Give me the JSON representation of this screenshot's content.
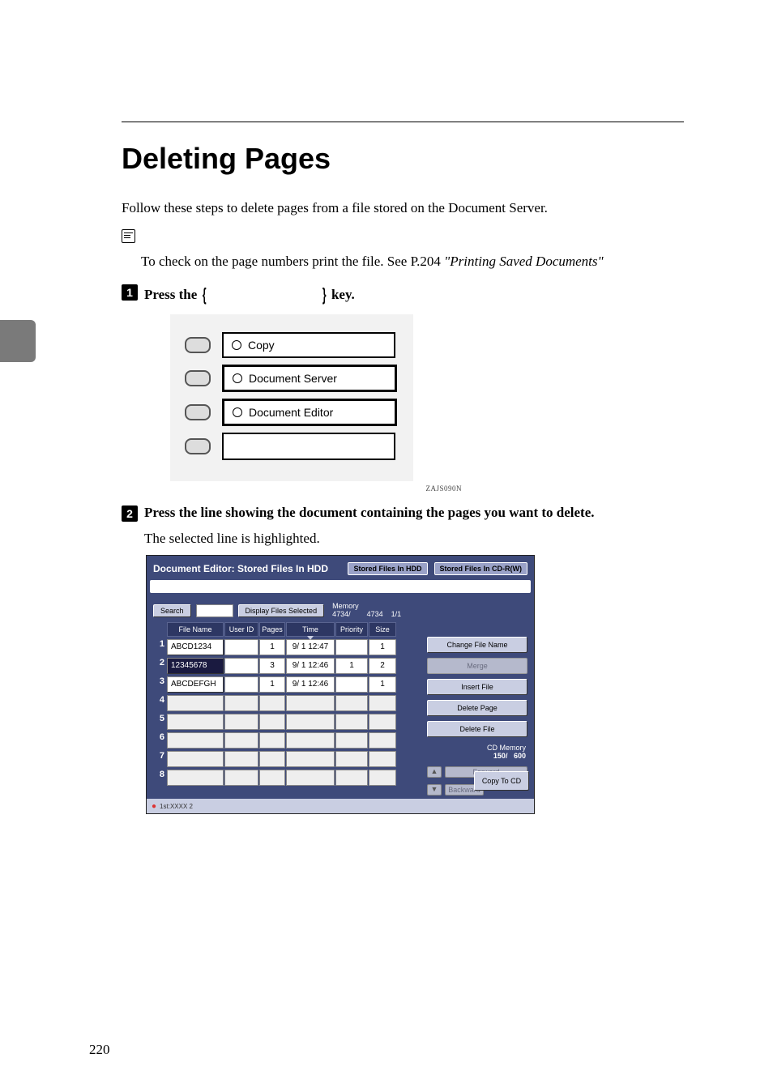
{
  "title": "Deleting Pages",
  "intro": "Follow these steps to delete pages from a file stored on the Document Server.",
  "note": {
    "prefix": "To check on the page numbers print the file. See ",
    "refpage": "P.204 ",
    "reftitle": "\"Printing Saved Documents\""
  },
  "steps": {
    "s1_a": "Press the ",
    "s1_key": "Document Editor",
    "s1_b": " key.",
    "s2": "Press the line showing the document containing the pages you want to delete.",
    "s2_body": "The selected line is highlighted."
  },
  "mode_panel": {
    "items": [
      "Copy",
      "Document Server",
      "Document Editor"
    ],
    "code": "ZAJS090N"
  },
  "screen": {
    "title": "Document Editor: Stored Files In HDD",
    "tabs": {
      "hdd": "Stored Files In HDD",
      "cd": "Stored Files In CD-R(W)"
    },
    "toolbar": {
      "search": "Search",
      "display": "Display Files Selected",
      "memory_label": "Memory",
      "memory_cur": "4734",
      "memory_tot": "4734",
      "page_cur": "1",
      "page_tot": "1"
    },
    "columns": [
      "File Name",
      "User ID",
      "Pages",
      "Time",
      "Priority",
      "Size"
    ],
    "rows": [
      {
        "n": "1",
        "fn": "ABCD1234",
        "uid": "",
        "pages": "1",
        "time": "9/ 1 12:47",
        "pri": "",
        "size": "1",
        "sel": false
      },
      {
        "n": "2",
        "fn": "12345678",
        "uid": "",
        "pages": "3",
        "time": "9/ 1 12:46",
        "pri": "1",
        "size": "2",
        "sel": true
      },
      {
        "n": "3",
        "fn": "ABCDEFGH",
        "uid": "",
        "pages": "1",
        "time": "9/ 1 12:46",
        "pri": "",
        "size": "1",
        "sel": false
      },
      {
        "n": "4",
        "fn": "",
        "uid": "",
        "pages": "",
        "time": "",
        "pri": "",
        "size": "",
        "sel": false
      },
      {
        "n": "5",
        "fn": "",
        "uid": "",
        "pages": "",
        "time": "",
        "pri": "",
        "size": "",
        "sel": false
      },
      {
        "n": "6",
        "fn": "",
        "uid": "",
        "pages": "",
        "time": "",
        "pri": "",
        "size": "",
        "sel": false
      },
      {
        "n": "7",
        "fn": "",
        "uid": "",
        "pages": "",
        "time": "",
        "pri": "",
        "size": "",
        "sel": false
      },
      {
        "n": "8",
        "fn": "",
        "uid": "",
        "pages": "",
        "time": "",
        "pri": "",
        "size": "",
        "sel": false
      }
    ],
    "side": {
      "change": "Change File Name",
      "merge": "Merge",
      "insert": "Insert File",
      "delpage": "Delete Page",
      "delfile": "Delete File",
      "cdmem_label": "CD Memory",
      "cdmem_cur": "150",
      "cdmem_tot": "600",
      "forward": "Forward",
      "backward": "Backward",
      "copycd": "Copy To CD"
    },
    "status": "1st:XXXX\n2"
  },
  "page_number": "220"
}
